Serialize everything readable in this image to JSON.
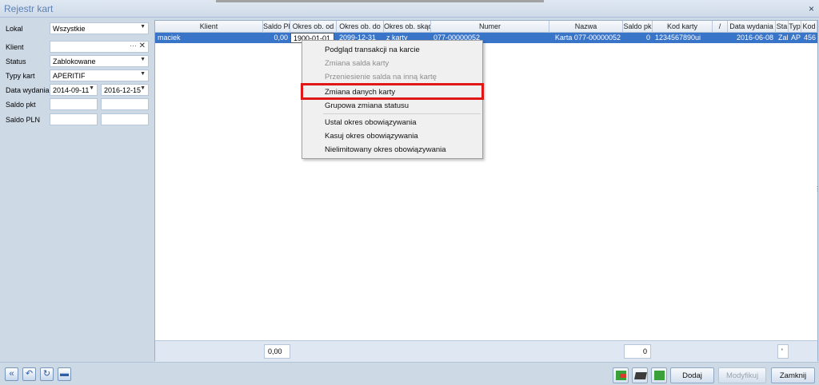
{
  "window": {
    "title": "Rejestr kart",
    "close_glyph": "×"
  },
  "filters": {
    "lokal": {
      "label": "Lokal",
      "value": "Wszystkie"
    },
    "klient": {
      "label": "Klient",
      "value": "",
      "dots": "···",
      "clear": "✕"
    },
    "status": {
      "label": "Status",
      "value": "Zablokowane"
    },
    "typy_kart": {
      "label": "Typy kart",
      "value": "APERITIF"
    },
    "data_wydania": {
      "label": "Data wydania",
      "from": "2014-09-11",
      "to": "2016-12-15"
    },
    "saldo_pkt": {
      "label": "Saldo pkt",
      "from": "",
      "to": ""
    },
    "saldo_pln": {
      "label": "Saldo PLN",
      "from": "",
      "to": ""
    }
  },
  "grid": {
    "columns": [
      "Klient",
      "Saldo Pl",
      "Okres ob. od",
      "Okres ob. do",
      "Okres ob. skąd",
      "Numer",
      "Nazwa",
      "Saldo pk",
      "Kod karty",
      "/",
      "Data wydania",
      "Sta",
      "Typ",
      "Kod"
    ],
    "row": {
      "klient": "maciek",
      "saldo_pln": "0,00",
      "okres_od": "1900-01-01",
      "okres_do": "2099-12-31",
      "okres_skad": "z karty",
      "numer": "077-00000052",
      "nazwa": "Karta 077-00000052",
      "saldo_pkt": "0",
      "kod_karty": "1234567890ui",
      "data_wydania": "2016-06-08",
      "status": "Zal",
      "typ": "AP",
      "kod": "456"
    },
    "footer": {
      "saldo_pln_total": "0,00",
      "saldo_pkt_total": "0",
      "last": "'"
    }
  },
  "context_menu": {
    "items": [
      {
        "label": "Podgląd transakcji na karcie",
        "enabled": true
      },
      {
        "label": "Zmiana salda karty",
        "enabled": false
      },
      {
        "label": "Przeniesienie salda na inną kartę",
        "enabled": false
      },
      {
        "label": "Zmiana danych karty",
        "enabled": true
      },
      {
        "label": "Grupowa zmiana statusu",
        "enabled": true
      },
      {
        "label": "Ustal okres obowiązywania",
        "enabled": true
      },
      {
        "label": "Kasuj okres obowiązywania",
        "enabled": true
      },
      {
        "label": "Nielimitowany okres obowiązywania",
        "enabled": true
      }
    ]
  },
  "toolbar": {
    "nav": {
      "back": "«",
      "undo": "↶",
      "refresh": "↻"
    },
    "dodaj": "Dodaj",
    "modyfikuj": "Modyfikuj",
    "zamknij": "Zamknij"
  },
  "colors": {
    "accent": "#3874c7",
    "highlight": "#e01717",
    "background": "#ced9e6"
  }
}
